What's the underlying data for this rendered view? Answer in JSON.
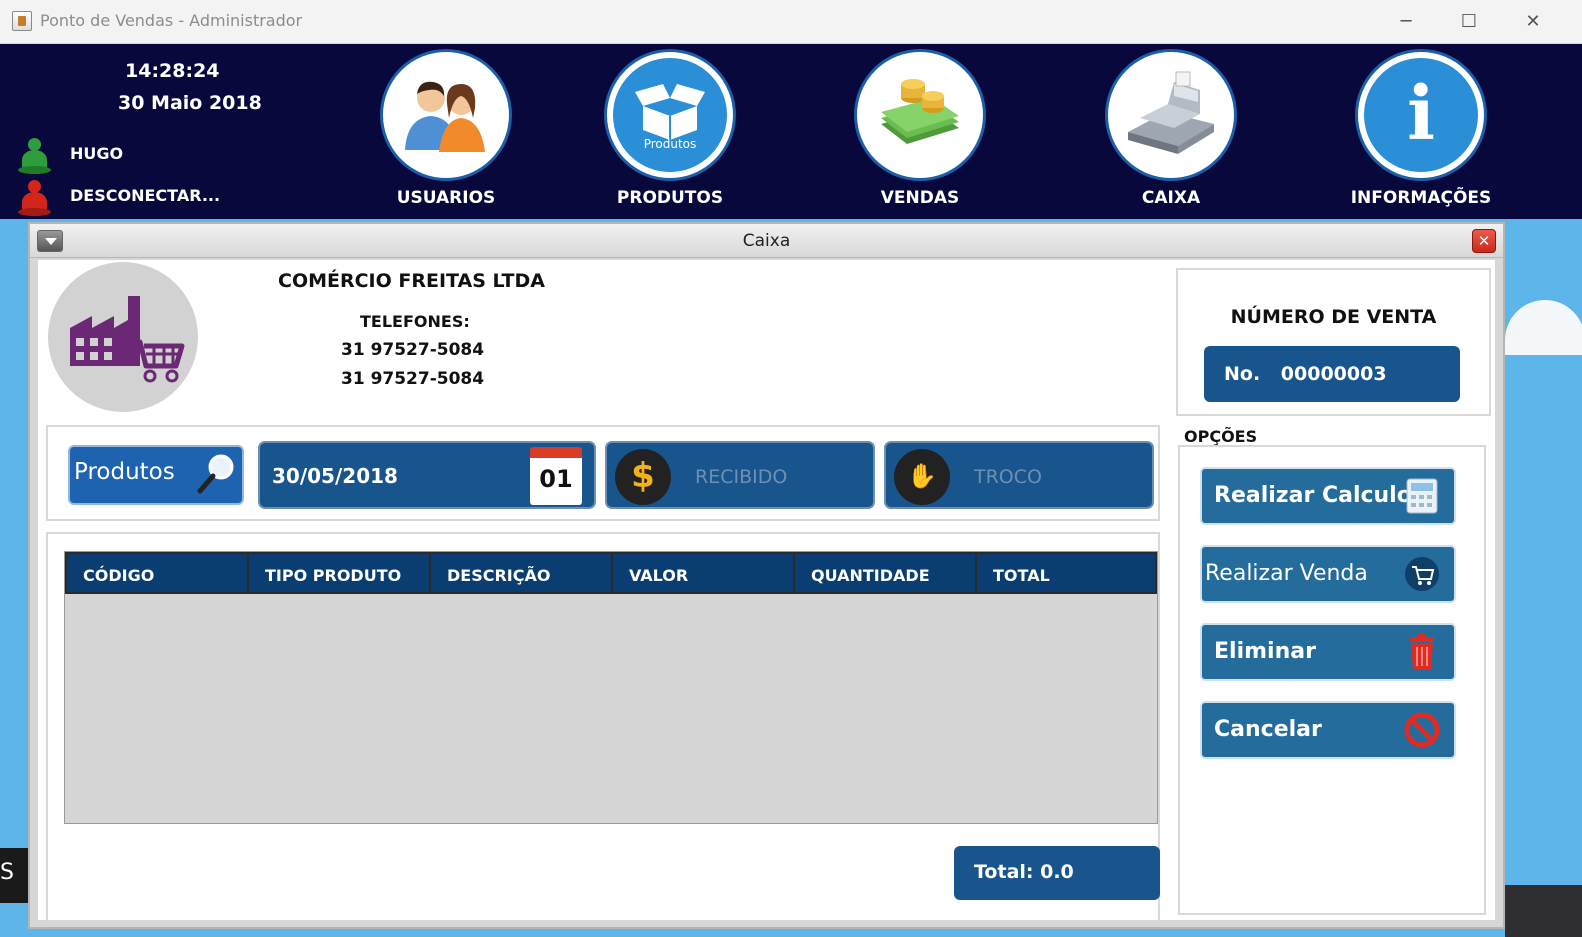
{
  "window": {
    "title": "Ponto de Vendas - Administrador",
    "minimize": "─",
    "maximize": "☐",
    "close": "✕"
  },
  "header": {
    "time": "14:28:24",
    "date": "30 Maio 2018",
    "user": "HUGO",
    "disconnect": "DESCONECTAR...",
    "nav": [
      {
        "label": "USUARIOS",
        "icon": "users-icon"
      },
      {
        "label": "PRODUTOS",
        "icon": "box-icon",
        "icon_text": "Produtos"
      },
      {
        "label": "VENDAS",
        "icon": "money-icon"
      },
      {
        "label": "CAIXA",
        "icon": "cash-register-icon"
      },
      {
        "label": "INFORMAÇÕES",
        "icon": "info-icon",
        "icon_text": "i"
      }
    ]
  },
  "dialog": {
    "title": "Caixa",
    "close": "✕",
    "company": "COMÉRCIO FREITAS LTDA",
    "phones_label": "TELEFONES:",
    "phones": [
      "31 97527-5084",
      "31 97527-5084"
    ],
    "sale_number_title": "NÚMERO DE VENTA",
    "sale_number": "No. 00000003",
    "products_button": "Produtos",
    "date_value": "30/05/2018",
    "calendar_day": "01",
    "received_placeholder": "RECIBIDO",
    "change_placeholder": "TROCO",
    "coin_symbol": "$",
    "columns": [
      "CÓDIGO",
      "TIPO PRODUTO",
      "DESCRIÇÃO",
      "VALOR",
      "QUANTIDADE",
      "TOTAL"
    ],
    "total": "Total: 0.0",
    "options_label": "OPÇÕES",
    "options": [
      "Realizar Calculo",
      "Realizar Venda",
      "Eliminar",
      "Cancelar"
    ]
  },
  "desktop_edge_text": "S",
  "colors": {
    "header_bg": "#08083d",
    "accent_blue": "#19558d",
    "button_blue": "#236c9c",
    "sky": "#5db5ea"
  }
}
